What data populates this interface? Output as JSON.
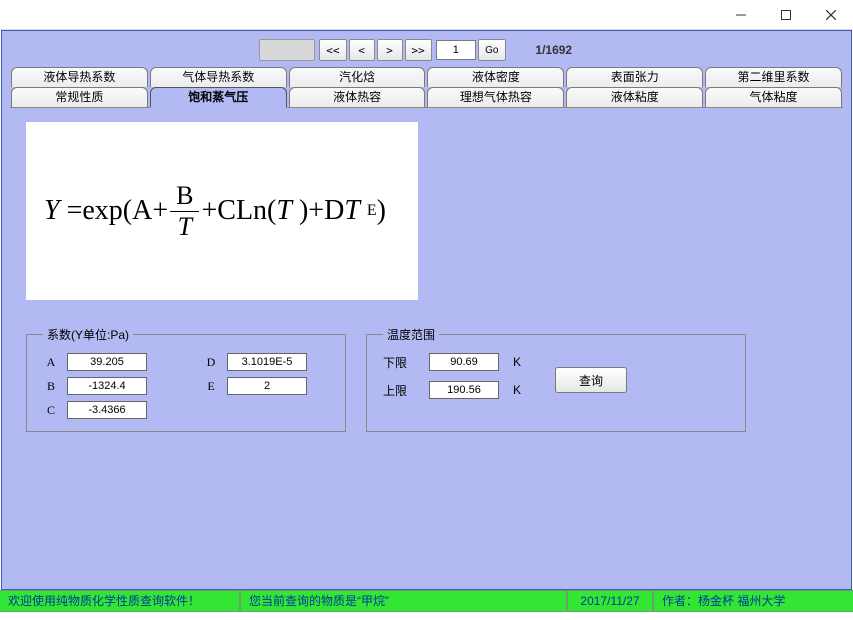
{
  "nav": {
    "first": "<<",
    "prev": "<",
    "next": ">",
    "last": ">>",
    "page_input": "1",
    "go_label": "Go",
    "counter": "1/1692"
  },
  "tabs_row1": {
    "t0": "液体导热系数",
    "t1": "气体导热系数",
    "t2": "汽化焓",
    "t3": "液体密度",
    "t4": "表面张力",
    "t5": "第二维里系数"
  },
  "tabs_row2": {
    "t0": "常规性质",
    "t1": "饱和蒸气压",
    "t2": "液体热容",
    "t3": "理想气体热容",
    "t4": "液体粘度",
    "t5": "气体粘度"
  },
  "coef": {
    "legend": "系数(Y单位:Pa)",
    "labels": {
      "A": "A",
      "B": "B",
      "C": "C",
      "D": "D",
      "E": "E"
    },
    "A": "39.205",
    "B": "-1324.4",
    "C": "-3.4366",
    "D": "3.1019E-5",
    "E": "2"
  },
  "range": {
    "legend": "温度范围",
    "lower_label": "下限",
    "upper_label": "上限",
    "unit": "K",
    "lower": "90.69",
    "upper": "190.56",
    "query_label": "查询"
  },
  "status": {
    "welcome": "欢迎使用纯物质化学性质查询软件！",
    "current": "您当前查询的物质是“甲烷”",
    "date": "2017/11/27",
    "author": "作者：杨金杯   福州大学"
  }
}
